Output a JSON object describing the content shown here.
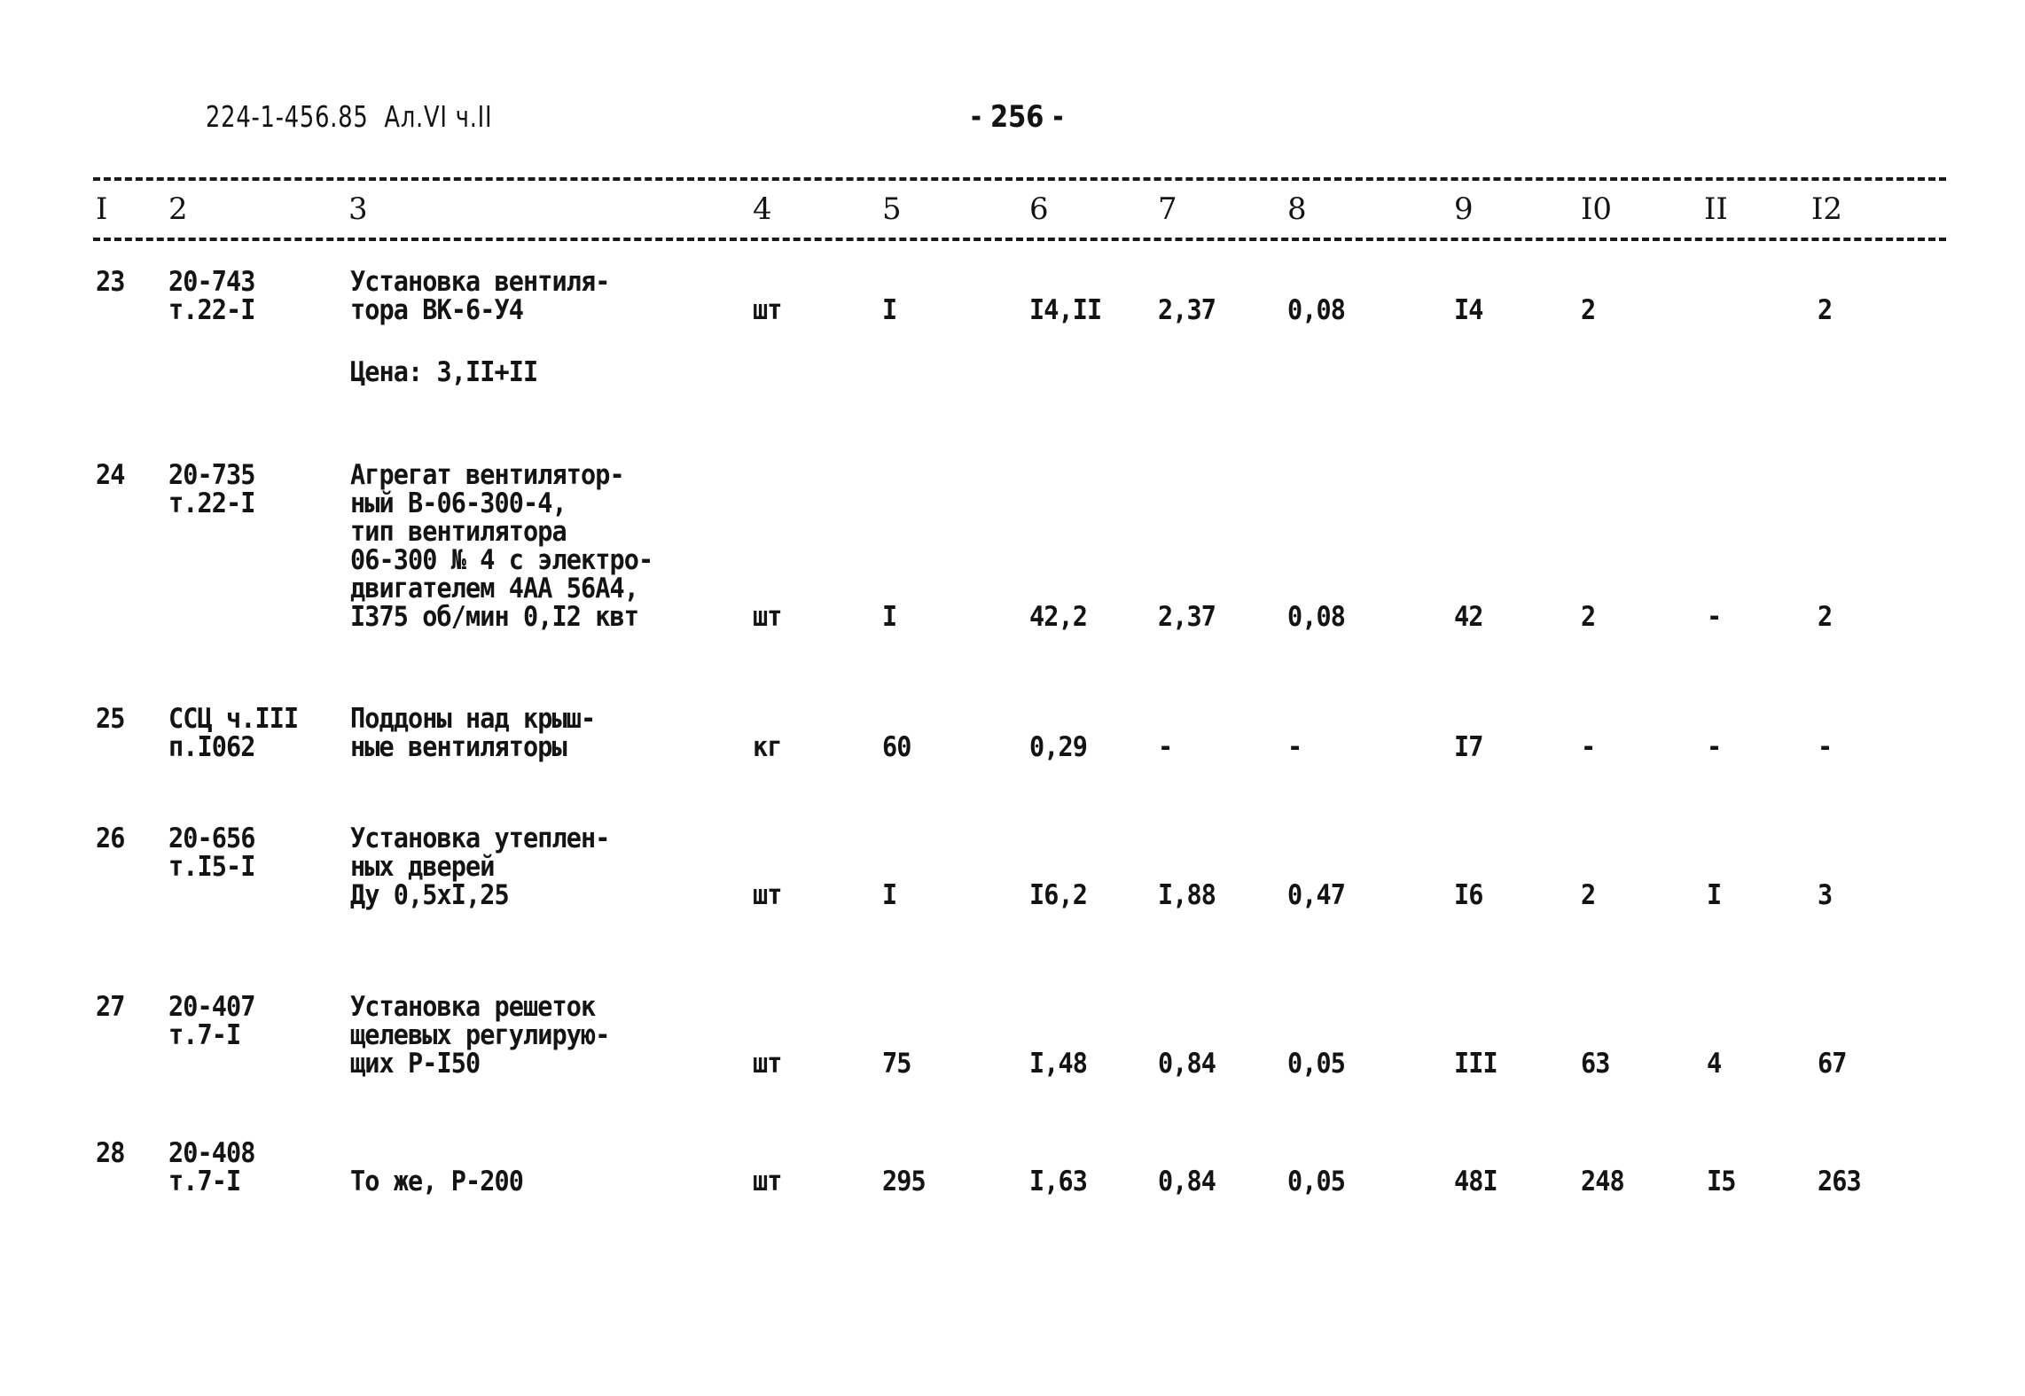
{
  "header": {
    "doc_code": "224-1-456.85  Ал.VI ч.II",
    "page_number": "- 256 -"
  },
  "columns": [
    "I",
    "2",
    "3",
    "4",
    "5",
    "6",
    "7",
    "8",
    "9",
    "I0",
    "II",
    "I2"
  ],
  "rows": [
    {
      "num": "23",
      "code": [
        "20-743",
        "т.22-I"
      ],
      "description": [
        "Установка вентиля-",
        "тора ВК-6-У4"
      ],
      "note": "Цена: 3,II+II",
      "unit": "шт",
      "qty": "I",
      "c6": "I4,II",
      "c7": "2,37",
      "c8": "0,08",
      "c9": "I4",
      "c10": "2",
      "c11": "",
      "c12": "2"
    },
    {
      "num": "24",
      "code": [
        "20-735",
        "т.22-I"
      ],
      "description": [
        "Агрегат вентилятор-",
        "ный В-06-300-4,",
        "тип вентилятора",
        "06-300 № 4 с электро-",
        "двигателем 4АА 56А4,",
        "I375 об/мин 0,I2 квт"
      ],
      "note": "",
      "unit": "шт",
      "qty": "I",
      "c6": "42,2",
      "c7": "2,37",
      "c8": "0,08",
      "c9": "42",
      "c10": "2",
      "c11": "-",
      "c12": "2"
    },
    {
      "num": "25",
      "code": [
        "ССЦ ч.III",
        "п.I062"
      ],
      "description": [
        "Поддоны над крыш-",
        "ные вентиляторы"
      ],
      "note": "",
      "unit": "кг",
      "qty": "60",
      "c6": "0,29",
      "c7": "-",
      "c8": "-",
      "c9": "I7",
      "c10": "-",
      "c11": "-",
      "c12": "-"
    },
    {
      "num": "26",
      "code": [
        "20-656",
        "т.I5-I"
      ],
      "description": [
        "Установка утеплен-",
        "ных дверей",
        "Ду 0,5хI,25"
      ],
      "note": "",
      "unit": "шт",
      "qty": "I",
      "c6": "I6,2",
      "c7": "I,88",
      "c8": "0,47",
      "c9": "I6",
      "c10": "2",
      "c11": "I",
      "c12": "3"
    },
    {
      "num": "27",
      "code": [
        "20-407",
        "т.7-I"
      ],
      "description": [
        "Установка решеток",
        "щелевых регулирую-",
        "щих Р-I50"
      ],
      "note": "",
      "unit": "шт",
      "qty": "75",
      "c6": "I,48",
      "c7": "0,84",
      "c8": "0,05",
      "c9": "III",
      "c10": "63",
      "c11": "4",
      "c12": "67"
    },
    {
      "num": "28",
      "code": [
        "20-408",
        "т.7-I"
      ],
      "description": [
        "",
        "То же, Р-200"
      ],
      "note": "",
      "unit": "шт",
      "qty": "295",
      "c6": "I,63",
      "c7": "0,84",
      "c8": "0,05",
      "c9": "48I",
      "c10": "248",
      "c11": "I5",
      "c12": "263"
    }
  ]
}
